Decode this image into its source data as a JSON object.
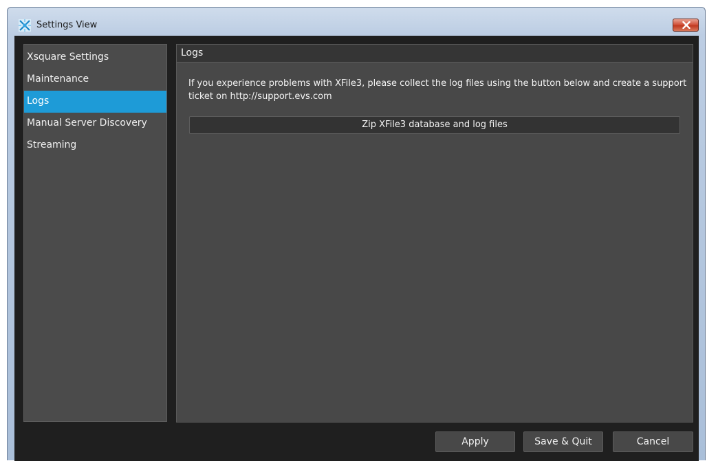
{
  "window": {
    "title": "Settings View",
    "close_icon": "close-icon"
  },
  "sidebar": {
    "items": [
      {
        "label": "Xsquare Settings",
        "active": false
      },
      {
        "label": "Maintenance",
        "active": false
      },
      {
        "label": "Logs",
        "active": true
      },
      {
        "label": "Manual Server Discovery",
        "active": false
      },
      {
        "label": "Streaming",
        "active": false
      }
    ]
  },
  "panel": {
    "title": "Logs",
    "description": "If you experience problems with XFile3, please collect the log files using the button below and create a support ticket on http://support.evs.com",
    "zip_button_label": "Zip XFile3 database and log files"
  },
  "footer": {
    "apply_label": "Apply",
    "save_quit_label": "Save & Quit",
    "cancel_label": "Cancel"
  },
  "colors": {
    "accent": "#1e9bd7",
    "background": "#1f1f1f",
    "panel": "#484848",
    "close_button": "#c0391f"
  }
}
